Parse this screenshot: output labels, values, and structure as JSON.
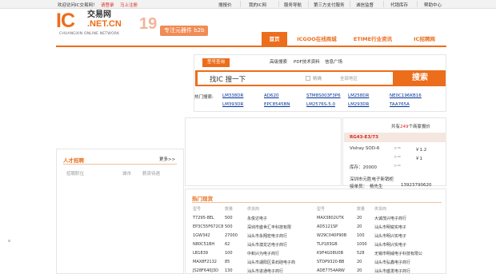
{
  "topbar": {
    "welcome": "欢迎访问IC交易网！",
    "login": "请登录",
    "register": "马上注册",
    "links": [
      "搜报价",
      "我的IC网",
      "服务导航",
      "第三方支付服务",
      "诚信监督",
      "代销库存",
      "帮助中心"
    ]
  },
  "logo": {
    "ic": "IC",
    "cn_text": "交易网",
    "net": ".NET.CN",
    "sub": "CHUANGXIN ONLINE NETWORK",
    "years": "19",
    "slogan": "专注元器件 b2b"
  },
  "nav": {
    "items": [
      "首页",
      "ICGOO在线商城",
      "ETIME行业资讯",
      "IC招聘网"
    ],
    "active": 0
  },
  "search": {
    "tabs": [
      "型号查询",
      "高级搜索",
      "PDF技术资料",
      "信息广场"
    ],
    "placeholder": "找IC  搜一下",
    "exact_label": "精确",
    "region": "全部地区",
    "button": "搜索"
  },
  "hot_search": {
    "label": "热门搜索:",
    "keywords": [
      "LM338DR",
      "AD620",
      "STM8S003F3P6",
      "LM258DR",
      "NE0C196KB16",
      "LM393DR",
      "EPC8545BN",
      "LM2576S-5.0",
      "LM293DR",
      "TAA765A"
    ]
  },
  "talent": {
    "title": "人才招聘",
    "more": "更多>>",
    "cols": [
      "招聘职位",
      "城市",
      "薪资待遇"
    ]
  },
  "quote": {
    "header_pre": "共有",
    "count": "249",
    "header_post": "个商家报价",
    "part": "RG43-E3/73",
    "rows": [
      {
        "brand": "Vishay SOD-6",
        "price": "￥1.2"
      },
      {
        "brand": "",
        "price": "￥1"
      },
      {
        "brand": "库存：20000",
        "price": ""
      }
    ],
    "company": "深圳市元胜电子新销柜",
    "contact_label": "接单员：",
    "contact": "杨先生",
    "phone": "13923790620"
  },
  "hot_stock": {
    "title": "热门现货",
    "headers": [
      "型号",
      "数量",
      "供货商",
      "型号",
      "数量",
      "供货商"
    ],
    "rows": [
      [
        "T7295-8EL",
        "500",
        "永俊达电子",
        "MAX3802UTK",
        "20",
        "大诚茂兴电子商行"
      ],
      [
        "EP3C55F672C8",
        "500",
        "深圳市盛世汇丰科技有限",
        "AD5121SP",
        "20",
        "汕头市明锐实电子"
      ],
      [
        "1GW342",
        "27000",
        "汕头市永翔宏电子商行",
        "W29C040P90B",
        "100",
        "汕头市明兴实电子"
      ],
      [
        "N80C51BH",
        "62",
        "汕头市澳龙达电子商行",
        "TLP183GB",
        "1000",
        "汕头市明兴实电子"
      ],
      [
        "LB1839",
        "100",
        "中和兴为电子商行",
        "K9F4G08U0B",
        "528",
        "无锡市明威电子科技有限公"
      ],
      [
        "MAX8F2132",
        "85",
        "汕头市湖阳区贵屿硅电子商",
        "STDP9320-BB",
        "20",
        "汕头市弘鑫电子商行"
      ],
      [
        "JS28F640J3D",
        "130",
        "汕头市进通电子商行",
        "ADE7754ARW",
        "20",
        "汕头市盛发电子商行"
      ]
    ]
  },
  "colors": {
    "accent": "#ec6d1b",
    "link": "#003399"
  }
}
